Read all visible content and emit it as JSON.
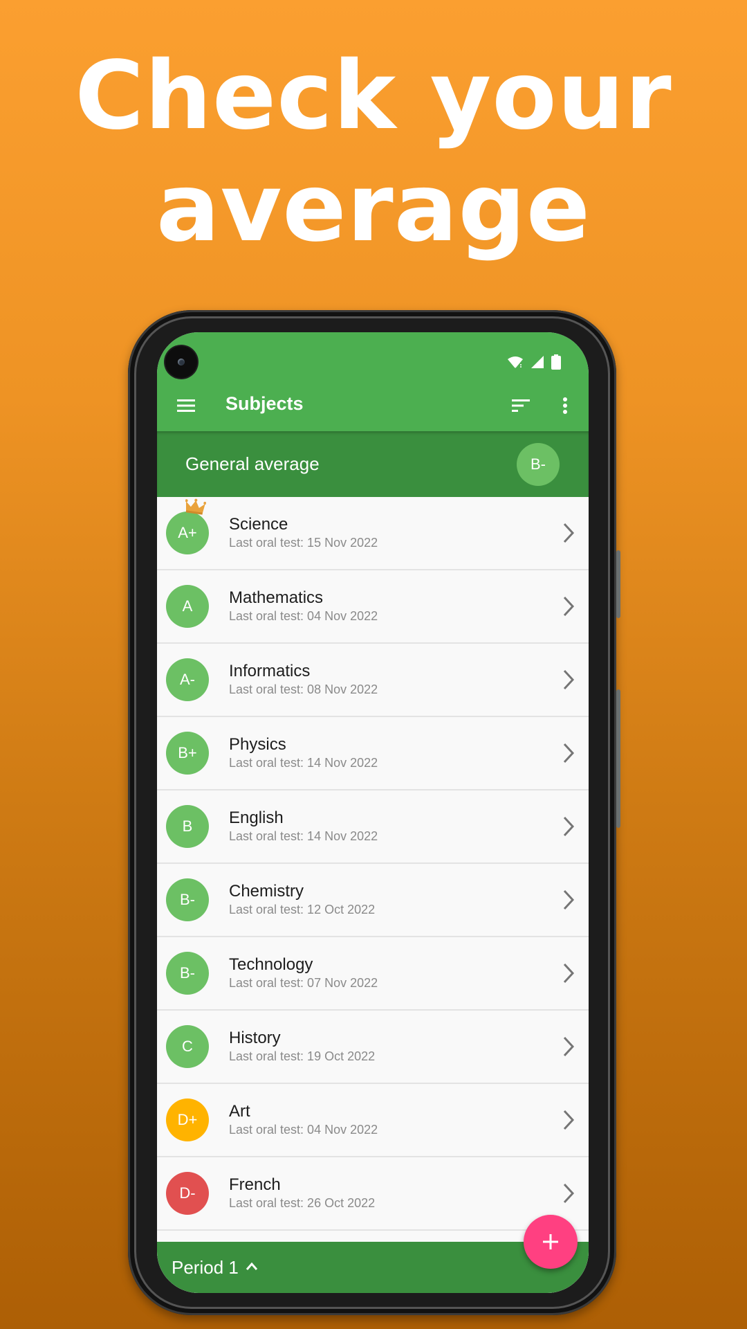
{
  "promo": {
    "headline_line1": "Check your",
    "headline_line2": "average"
  },
  "status_bar": {
    "icons": [
      "wifi-icon",
      "cell-signal-icon",
      "battery-icon"
    ]
  },
  "toolbar": {
    "title": "Subjects",
    "menu_icon": "hamburger-menu-icon",
    "sort_icon": "sort-icon",
    "more_icon": "more-vertical-icon"
  },
  "general_average": {
    "label": "General average",
    "grade": "B-"
  },
  "colors": {
    "primary": "#4caf50",
    "primary_dark": "#3a8f3e",
    "grade_green": "#6cc064",
    "grade_yellow": "#ffb300",
    "grade_red": "#e15050",
    "fab": "#ff4081"
  },
  "subjects": [
    {
      "name": "Science",
      "grade": "A+",
      "subtitle": "Last oral test: 15 Nov 2022",
      "color": "#6cc064",
      "crown": true
    },
    {
      "name": "Mathematics",
      "grade": "A",
      "subtitle": "Last oral test: 04 Nov 2022",
      "color": "#6cc064",
      "crown": false
    },
    {
      "name": "Informatics",
      "grade": "A-",
      "subtitle": "Last oral test: 08 Nov 2022",
      "color": "#6cc064",
      "crown": false
    },
    {
      "name": "Physics",
      "grade": "B+",
      "subtitle": "Last oral test: 14 Nov 2022",
      "color": "#6cc064",
      "crown": false
    },
    {
      "name": "English",
      "grade": "B",
      "subtitle": "Last oral test: 14 Nov 2022",
      "color": "#6cc064",
      "crown": false
    },
    {
      "name": "Chemistry",
      "grade": "B-",
      "subtitle": "Last oral test: 12 Oct 2022",
      "color": "#6cc064",
      "crown": false
    },
    {
      "name": "Technology",
      "grade": "B-",
      "subtitle": "Last oral test: 07 Nov 2022",
      "color": "#6cc064",
      "crown": false
    },
    {
      "name": "History",
      "grade": "C",
      "subtitle": "Last oral test: 19 Oct 2022",
      "color": "#6cc064",
      "crown": false
    },
    {
      "name": "Art",
      "grade": "D+",
      "subtitle": "Last oral test: 04 Nov 2022",
      "color": "#ffb300",
      "crown": false
    },
    {
      "name": "French",
      "grade": "D-",
      "subtitle": "Last oral test: 26 Oct 2022",
      "color": "#e15050",
      "crown": false
    }
  ],
  "bottom_bar": {
    "period_label": "Period 1"
  },
  "fab": {
    "icon": "plus-icon"
  }
}
